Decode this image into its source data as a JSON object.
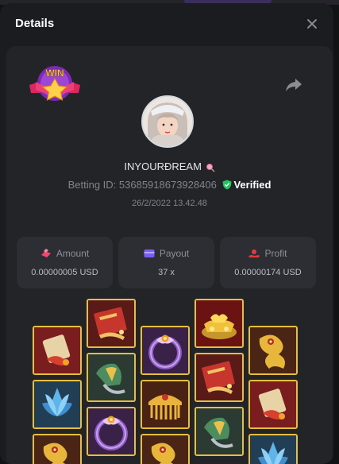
{
  "modal": {
    "title": "Details"
  },
  "player": {
    "username": "INYOURĐREAM",
    "betting_id_label": "Betting ID:",
    "betting_id": "53685918673928406",
    "verified_label": "Verified",
    "datetime": "26/2/2022 13.42.48"
  },
  "badge": {
    "text": "WIN"
  },
  "stats": {
    "amount": {
      "label": "Amount",
      "value": "0.00000005 USD"
    },
    "payout": {
      "label": "Payout",
      "value": "37 x"
    },
    "profit": {
      "label": "Profit",
      "value": "0.00000174 USD"
    }
  },
  "colors": {
    "accent_green": "#22c55e",
    "tile_border": "#e5c03f",
    "stat_icon_pink": "#ef476f",
    "stat_icon_purple": "#7b5cf5",
    "stat_icon_red": "#e23b3b"
  },
  "reels": [
    [
      "scroll-fish",
      "sapphire-lotus",
      "golden-dragon"
    ],
    [
      "red-tome",
      "jade-fan",
      "violet-jewel-ring"
    ],
    [
      "violet-jewel-ring",
      "golden-comb",
      "golden-dragon"
    ],
    [
      "gold-ingots",
      "red-tome",
      "jade-fan"
    ],
    [
      "golden-dragon",
      "scroll-fish",
      "sapphire-lotus"
    ]
  ]
}
